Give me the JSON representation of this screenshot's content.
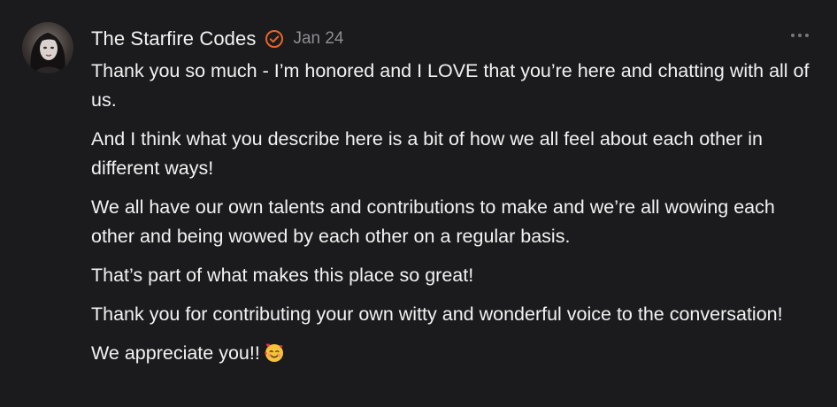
{
  "comment": {
    "author": "The Starfire Codes",
    "date": "Jan 24",
    "verified_icon": "check-circle-icon",
    "accent_color": "#e8652a",
    "menu_icon": "more-horizontal-icon",
    "paragraphs": [
      "Thank you so much - I’m honored and I LOVE that you’re here and chatting with all of us.",
      "And I think what you describe here is a bit of how we all feel about each other in different ways!",
      "We all have our own talents and contributions to make and we’re all wowing each other and being wowed by each other on a regular basis.",
      "That’s part of what makes this place so great!",
      "Thank you for contributing your own witty and wonderful voice to the conversation!",
      "We appreciate you!!"
    ],
    "closing_emoji": "smiling-face-with-hearts-emoji"
  }
}
